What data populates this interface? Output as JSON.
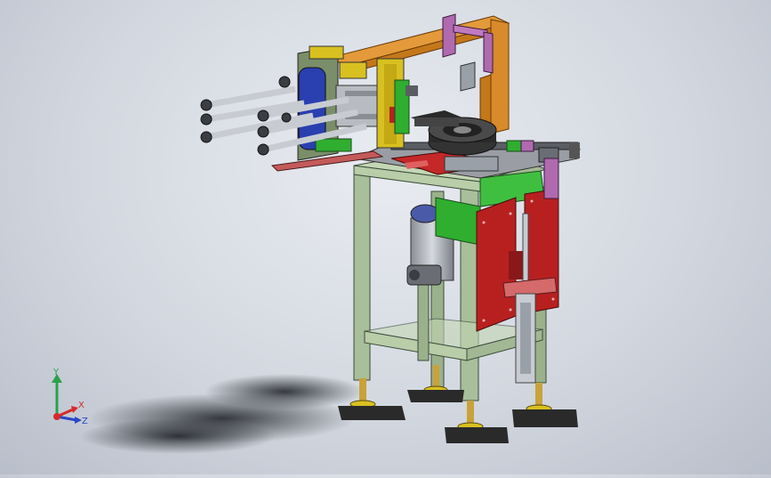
{
  "viewport": {
    "background_center": "#e9ecf1",
    "background_edge": "#b9bfca"
  },
  "triad": {
    "x_label": "X",
    "y_label": "Y",
    "z_label": "Z",
    "x_color": "#d62a2a",
    "y_color": "#2aa24a",
    "z_color": "#2a46c8"
  },
  "model": {
    "frame_color": "#a8bf9a",
    "frame_edge": "#3a4a3a",
    "arch_color": "#d98a2a",
    "plate_color": "#b82020",
    "panel_green": "#2fae2f",
    "purple_color": "#b06ab0",
    "rod_color": "#c8ccd2",
    "dark_color": "#2a2a2a",
    "yellow_color": "#d8c020",
    "blue_color": "#2a3fb0",
    "pink_color": "#d46a6a"
  }
}
